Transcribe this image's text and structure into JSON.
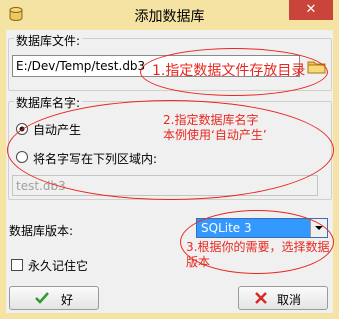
{
  "window": {
    "title": "添加数据库",
    "close_glyph": "✕"
  },
  "file_group": {
    "label": "数据库文件:",
    "path": "E:/Dev/Temp/test.db3"
  },
  "name_group": {
    "label": "数据库名字:",
    "option_auto": "自动产生",
    "option_manual": "将名字写在下列区域内:",
    "name_value": "test.db3",
    "selected": "auto"
  },
  "version": {
    "label": "数据库版本:",
    "selected": "SQLite 3"
  },
  "remember": {
    "label": "永久记住它",
    "checked": false
  },
  "buttons": {
    "ok": "好",
    "cancel": "取消"
  },
  "annotations": {
    "file": "1.指定数据文件存放目录",
    "name_line1": "2.指定数据库名字",
    "name_line2": "本例使用‘自动产生’",
    "version_line1": "3.根据你的需要，选择数据",
    "version_line2": "版本"
  },
  "colors": {
    "annotation": "#e8281f",
    "title_bar": "#f5e3a3",
    "close_button": "#c9453c",
    "selection": "#3399ff"
  },
  "icons": {
    "app": "database-icon",
    "browse": "folder-icon",
    "ok": "check-icon",
    "cancel": "cross-icon"
  }
}
